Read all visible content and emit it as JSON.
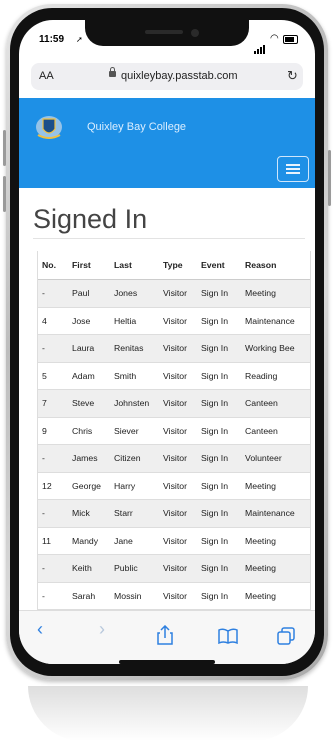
{
  "status_bar": {
    "time": "11:59"
  },
  "browser": {
    "text_size_label": "AA",
    "url": "quixleybay.passtab.com"
  },
  "site": {
    "brand": "Quixley Bay College"
  },
  "page": {
    "title": "Signed In"
  },
  "table": {
    "headers": [
      "No.",
      "First",
      "Last",
      "Type",
      "Event",
      "Reason"
    ],
    "rows": [
      [
        "-",
        "Paul",
        "Jones",
        "Visitor",
        "Sign In",
        "Meeting"
      ],
      [
        "4",
        "Jose",
        "Heltia",
        "Visitor",
        "Sign In",
        "Maintenance"
      ],
      [
        "-",
        "Laura",
        "Renitas",
        "Visitor",
        "Sign In",
        "Working Bee"
      ],
      [
        "5",
        "Adam",
        "Smith",
        "Visitor",
        "Sign In",
        "Reading"
      ],
      [
        "7",
        "Steve",
        "Johnsten",
        "Visitor",
        "Sign In",
        "Canteen"
      ],
      [
        "9",
        "Chris",
        "Siever",
        "Visitor",
        "Sign In",
        "Canteen"
      ],
      [
        "-",
        "James",
        "Citizen",
        "Visitor",
        "Sign In",
        "Volunteer"
      ],
      [
        "12",
        "George",
        "Harry",
        "Visitor",
        "Sign In",
        "Meeting"
      ],
      [
        "-",
        "Mick",
        "Starr",
        "Visitor",
        "Sign In",
        "Maintenance"
      ],
      [
        "11",
        "Mandy",
        "Jane",
        "Visitor",
        "Sign In",
        "Meeting"
      ],
      [
        "-",
        "Keith",
        "Public",
        "Visitor",
        "Sign In",
        "Meeting"
      ],
      [
        "-",
        "Sarah",
        "Mossin",
        "Visitor",
        "Sign In",
        "Meeting"
      ],
      [
        "",
        "",
        "",
        "",
        "",
        ""
      ]
    ]
  },
  "toolbar": {
    "back_icon": "chevron-left-icon",
    "forward_icon": "chevron-right-icon",
    "share_icon": "share-icon",
    "bookmarks_icon": "book-icon",
    "tabs_icon": "tabs-icon"
  },
  "colors": {
    "header_blue": "#1e90e6",
    "link_blue": "#2f80e0"
  }
}
